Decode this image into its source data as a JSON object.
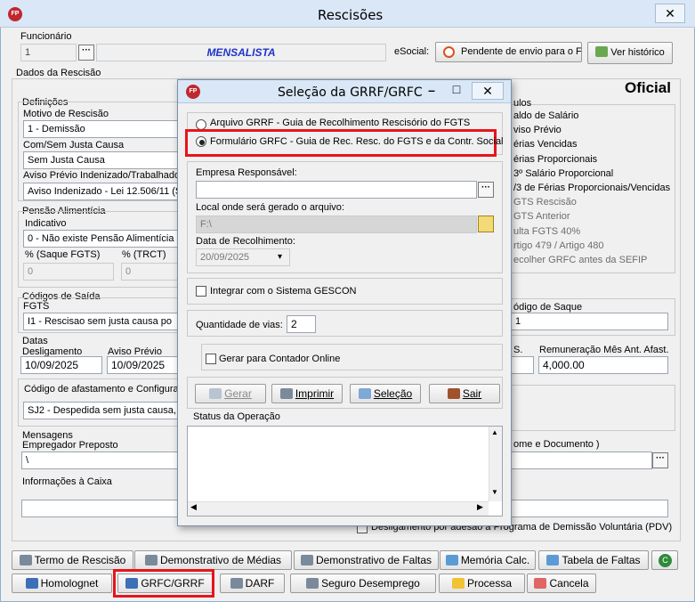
{
  "window": {
    "title": "Rescisões",
    "close": "✕",
    "app_icon": "FP"
  },
  "header": {
    "funcionario_label": "Funcionário",
    "funcionario_value": "1",
    "lookup_btn": "···",
    "employee_name": "MENSALISTA",
    "esocial_label": "eSocial:",
    "esocial_status": "Pendente de envio para o F",
    "historico_btn": "Ver histórico"
  },
  "dados": {
    "title": "Dados da Rescisão",
    "oficial": "Oficial",
    "definicoes": "Definições",
    "motivo_label": "Motivo de Rescisão",
    "motivo_value": "1 - Demissão",
    "justa_label": "Com/Sem Justa Causa",
    "justa_value": "Sem Justa Causa",
    "aviso_label": "Aviso Prévio Indenizado/Trabalhado",
    "aviso_value": "Aviso Indenizado - Lei 12.506/11 (S",
    "pensao_title": "Pensão Alimentícia",
    "indicativo_label": "Indicativo",
    "indicativo_value": "0 - Não existe Pensão Alimentícia",
    "saque_label": "% (Saque FGTS)",
    "saque_value": "0",
    "trct_label": "% (TRCT)",
    "trct_value": "0",
    "codigos_title": "Códigos de Saída",
    "fgts_label": "FGTS",
    "fgts_value": "I1 - Rescisao sem justa causa po",
    "datas_title": "Datas",
    "deslig_label": "Desligamento",
    "deslig_value": "10/09/2025",
    "avprev_label": "Aviso Prévio",
    "avprev_value": "10/09/2025",
    "afast_label": "Código de afastamento e Configuraç",
    "afast_value": "SJ2 - Despedida sem justa causa, p",
    "mensagens_title": "Mensagens",
    "preposto_label": "Empregador Preposto",
    "preposto_value": "\\",
    "caixa_label": "Informações à Caixa",
    "caixa_value": ""
  },
  "calc": {
    "title": "ulos",
    "items": [
      "aldo de Salário",
      "viso Prévio",
      "érias Vencidas",
      "érias Proporcionais",
      "3º Salário Proporcional",
      "/3 de Férias Proporcionais/Vencidas",
      "GTS Rescisão",
      "GTS Anterior",
      "ulta FGTS 40%",
      "rtigo 479 / Artigo 480",
      "ecolher GRFC antes da SEFIP"
    ],
    "cod_saque_label": "ódigo de Saque",
    "cod_saque_value": "1",
    "s_label": "S.",
    "remun_label": "Remuneração Mês Ant. Afast.",
    "remun_value": "4,000.00",
    "nome_doc_label": "ome e Documento )",
    "pdv_label": "Desligamento por adesão à Programa de Demissão Voluntária (PDV)"
  },
  "dialog": {
    "title": "Seleção da GRRF/GRFC",
    "min": "–",
    "max": "□",
    "close": "✕",
    "opt_grrf": "Arquivo GRRF - Guia de Recolhimento  Rescisório do FGTS",
    "opt_grfc": "Formulário GRFC - Guia de Rec. Resc. do FGTS e da Contr. Social",
    "empresa_label": "Empresa Responsável:",
    "empresa_value": "",
    "local_label": "Local onde será gerado o arquivo:",
    "local_value": "F:\\",
    "data_label": "Data de Recolhimento:",
    "data_value": "20/09/2025",
    "gescon_label": "Integrar com o Sistema GESCON",
    "vias_label": "Quantidade de vias:",
    "vias_value": "2",
    "contador_label": "Gerar para Contador Online",
    "btn_gerar": "Gerar",
    "btn_imprimir": "Imprimir",
    "btn_selecao": "Seleção",
    "btn_sair": "Sair",
    "status_label": "Status da Operação"
  },
  "bottom_row1": [
    "Termo de Rescisão",
    "Demonstrativo de Médias",
    "Demonstrativo de Faltas",
    "Memória Calc.",
    "Tabela de Faltas"
  ],
  "bottom_row2": [
    "Homolognet",
    "GRFC/GRRF",
    "DARF",
    "Seguro Desemprego",
    "Processa",
    "Cancela"
  ]
}
